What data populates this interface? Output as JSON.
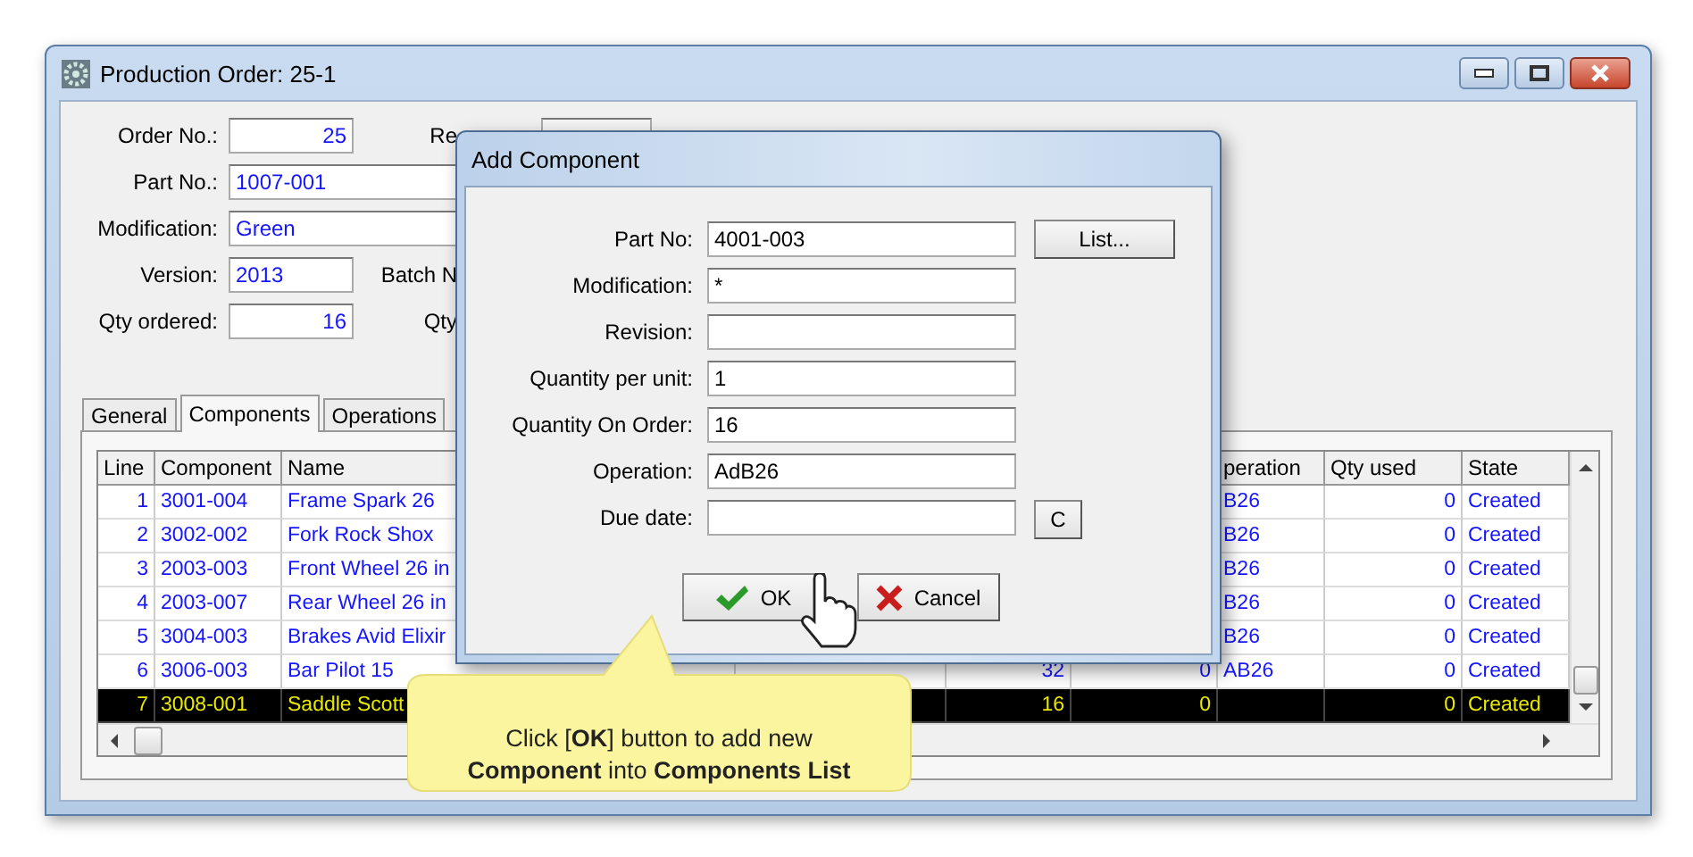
{
  "window": {
    "title": "Production Order: 25-1"
  },
  "form": [
    {
      "label": "Order No.:",
      "value": "25",
      "kind": "number",
      "extra": {
        "label": "Re",
        "kind": "field"
      }
    },
    {
      "label": "Part No.:",
      "value": "1007-001",
      "kind": "wide"
    },
    {
      "label": "Modification:",
      "value": "Green",
      "kind": "wide"
    },
    {
      "label": "Version:",
      "value": "2013",
      "kind": "short",
      "extra": {
        "label": "Batch N"
      }
    },
    {
      "label": "Qty ordered:",
      "value": "16",
      "kind": "number",
      "extra": {
        "label": "Qty"
      }
    }
  ],
  "tabs": [
    {
      "label": "General",
      "selected": false
    },
    {
      "label": "Components",
      "selected": true
    },
    {
      "label": "Operations",
      "selected": false
    }
  ],
  "table": {
    "columns": [
      {
        "label": "Line"
      },
      {
        "label": "Component"
      },
      {
        "label": "Name"
      },
      {},
      {},
      {},
      {
        "label": "peration"
      },
      {
        "label": "Qty used"
      },
      {
        "label": "State"
      }
    ],
    "rows": [
      {
        "selected": false,
        "cells": [
          "1",
          "3001-004",
          "Frame Spark 26",
          null,
          null,
          null,
          "B26",
          "0",
          "Created"
        ]
      },
      {
        "selected": false,
        "cells": [
          "2",
          "3002-002",
          "Fork Rock Shox",
          null,
          null,
          null,
          "B26",
          "0",
          "Created"
        ]
      },
      {
        "selected": false,
        "cells": [
          "3",
          "2003-003",
          "Front Wheel 26 in",
          null,
          null,
          null,
          "B26",
          "0",
          "Created"
        ]
      },
      {
        "selected": false,
        "cells": [
          "4",
          "2003-007",
          "Rear Wheel 26 in",
          null,
          null,
          null,
          "B26",
          "0",
          "Created"
        ]
      },
      {
        "selected": false,
        "cells": [
          "5",
          "3004-003",
          "Brakes Avid Elixir",
          null,
          null,
          null,
          "B26",
          "0",
          "Created"
        ]
      },
      {
        "selected": false,
        "cells": [
          "6",
          "3006-003",
          "Bar Pilot 15",
          null,
          "32",
          "0",
          "AB26",
          "0",
          "Created"
        ]
      },
      {
        "selected": true,
        "cells": [
          "7",
          "3008-001",
          "Saddle Scott",
          null,
          "16",
          "0",
          null,
          "0",
          "Created"
        ]
      }
    ]
  },
  "dialog": {
    "title": "Add Component",
    "fields": [
      {
        "label": "Part No:",
        "value": "4001-003"
      },
      {
        "label": "Modification:",
        "value": "*"
      },
      {
        "label": "Revision:"
      },
      {
        "label": "Quantity per unit:",
        "value": "1"
      },
      {
        "label": "Quantity On Order:",
        "value": "16"
      },
      {
        "label": "Operation:",
        "value": "AdB26"
      },
      {
        "label": "Due date:"
      }
    ],
    "list_button": "List...",
    "clear_button": "C",
    "ok_button": "OK",
    "cancel_button": "Cancel"
  },
  "callout": {
    "lines": [
      "Click [**OK**] button to add new",
      "**Component** into **Components List**"
    ]
  }
}
